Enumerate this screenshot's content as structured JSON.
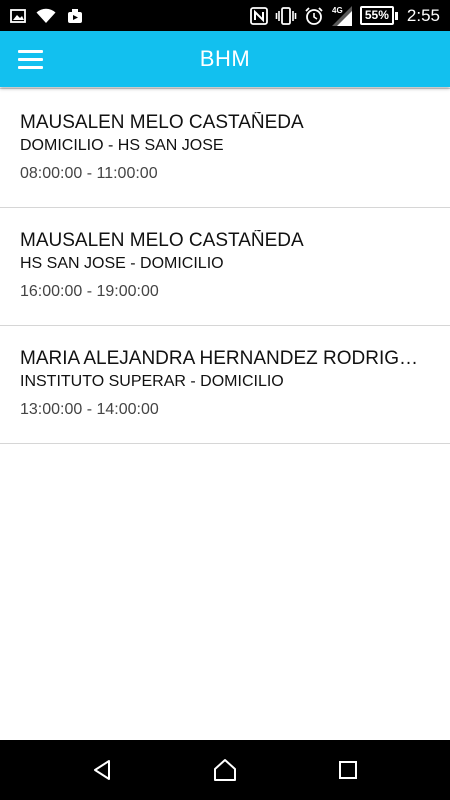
{
  "status_bar": {
    "left_icons": [
      "image-icon",
      "wifi-icon",
      "camera-icon"
    ],
    "right_icons": [
      "nfc-icon",
      "vibrate-icon",
      "alarm-icon",
      "signal-4g-icon"
    ],
    "network": "4G",
    "battery": "55%",
    "time": "2:55"
  },
  "app_bar": {
    "title": "BHM",
    "menu_icon": "hamburger-menu-icon",
    "color": "#12c0ef"
  },
  "items": [
    {
      "name": "MAUSALEN MELO CASTAÑEDA",
      "route": "DOMICILIO - HS SAN JOSE",
      "time": "08:00:00 - 11:00:00"
    },
    {
      "name": "MAUSALEN MELO CASTAÑEDA",
      "route": "HS SAN JOSE - DOMICILIO",
      "time": "16:00:00 - 19:00:00"
    },
    {
      "name": "MARIA ALEJANDRA HERNANDEZ RODRIGUEZ",
      "route": "INSTITUTO SUPERAR - DOMICILIO",
      "time": "13:00:00 - 14:00:00"
    }
  ],
  "nav_bar": {
    "buttons": [
      "back-icon",
      "home-icon",
      "recents-icon"
    ]
  }
}
